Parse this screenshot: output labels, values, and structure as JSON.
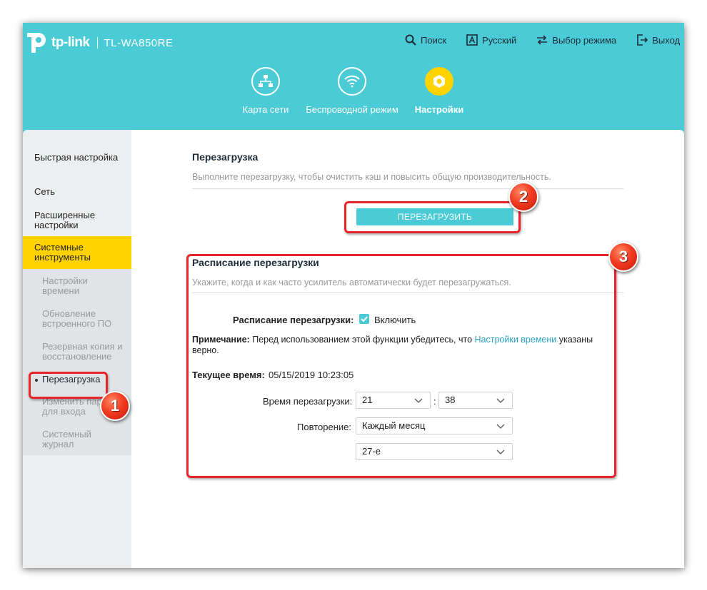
{
  "brand": {
    "logo_text": "tp-link",
    "model": "TL-WA850RE"
  },
  "toplinks": [
    {
      "label": "Поиск",
      "icon": "search-icon"
    },
    {
      "label": "Русский",
      "icon": "language-icon"
    },
    {
      "label": "Выбор режима",
      "icon": "mode-switch-icon"
    },
    {
      "label": "Выход",
      "icon": "logout-icon"
    }
  ],
  "navtabs": [
    {
      "label": "Карта сети",
      "icon": "network-map-icon",
      "active": false
    },
    {
      "label": "Беспроводной режим",
      "icon": "wifi-icon",
      "active": false
    },
    {
      "label": "Настройки",
      "icon": "gear-icon",
      "active": true
    }
  ],
  "sidebar": {
    "items": [
      {
        "label": "Быстрая настройка"
      },
      {
        "label": "Сеть"
      },
      {
        "label": "Расширенные настройки"
      },
      {
        "label": "Системные инструменты",
        "active": true
      }
    ],
    "subitems": [
      {
        "label": "Настройки времени"
      },
      {
        "label": "Обновление встроенного ПО"
      },
      {
        "label": "Резервная копия и восстановление"
      },
      {
        "label": "Перезагрузка",
        "selected": true
      },
      {
        "label": "Изменить пароль для входа"
      },
      {
        "label": "Системный журнал"
      }
    ]
  },
  "reboot": {
    "title": "Перезагрузка",
    "description": "Выполните перезагрузку, чтобы очистить кэш и повысить общую производительность.",
    "button_label": "ПЕРЕЗАГРУЗИТЬ"
  },
  "schedule": {
    "title": "Расписание перезагрузки",
    "description": "Укажите, когда и как часто усилитель автоматически будет перезагружаться.",
    "enable_label": "Расписание перезагрузки:",
    "enable_checkbox_label": "Включить",
    "enabled": true,
    "note_bold": "Примечание:",
    "note_text": " Перед использованием этой функции убедитесь, что ",
    "note_link": "Настройки времени",
    "note_tail": " указаны верно.",
    "current_time_label": "Текущее время:",
    "current_time_value": "05/15/2019 10:23:05",
    "reboot_time_label": "Время перезагрузки:",
    "reboot_hour": "21",
    "reboot_minute": "38",
    "time_separator": ":",
    "repeat_label": "Повторение:",
    "repeat_value": "Каждый месяц",
    "day_value": "27-е"
  },
  "annotations": {
    "badge1": "1",
    "badge2": "2",
    "badge3": "3",
    "color": "#e8242a"
  },
  "colors": {
    "accent": "#4acbd6",
    "active_tab": "#ffd200",
    "link": "#2aa3c4"
  }
}
